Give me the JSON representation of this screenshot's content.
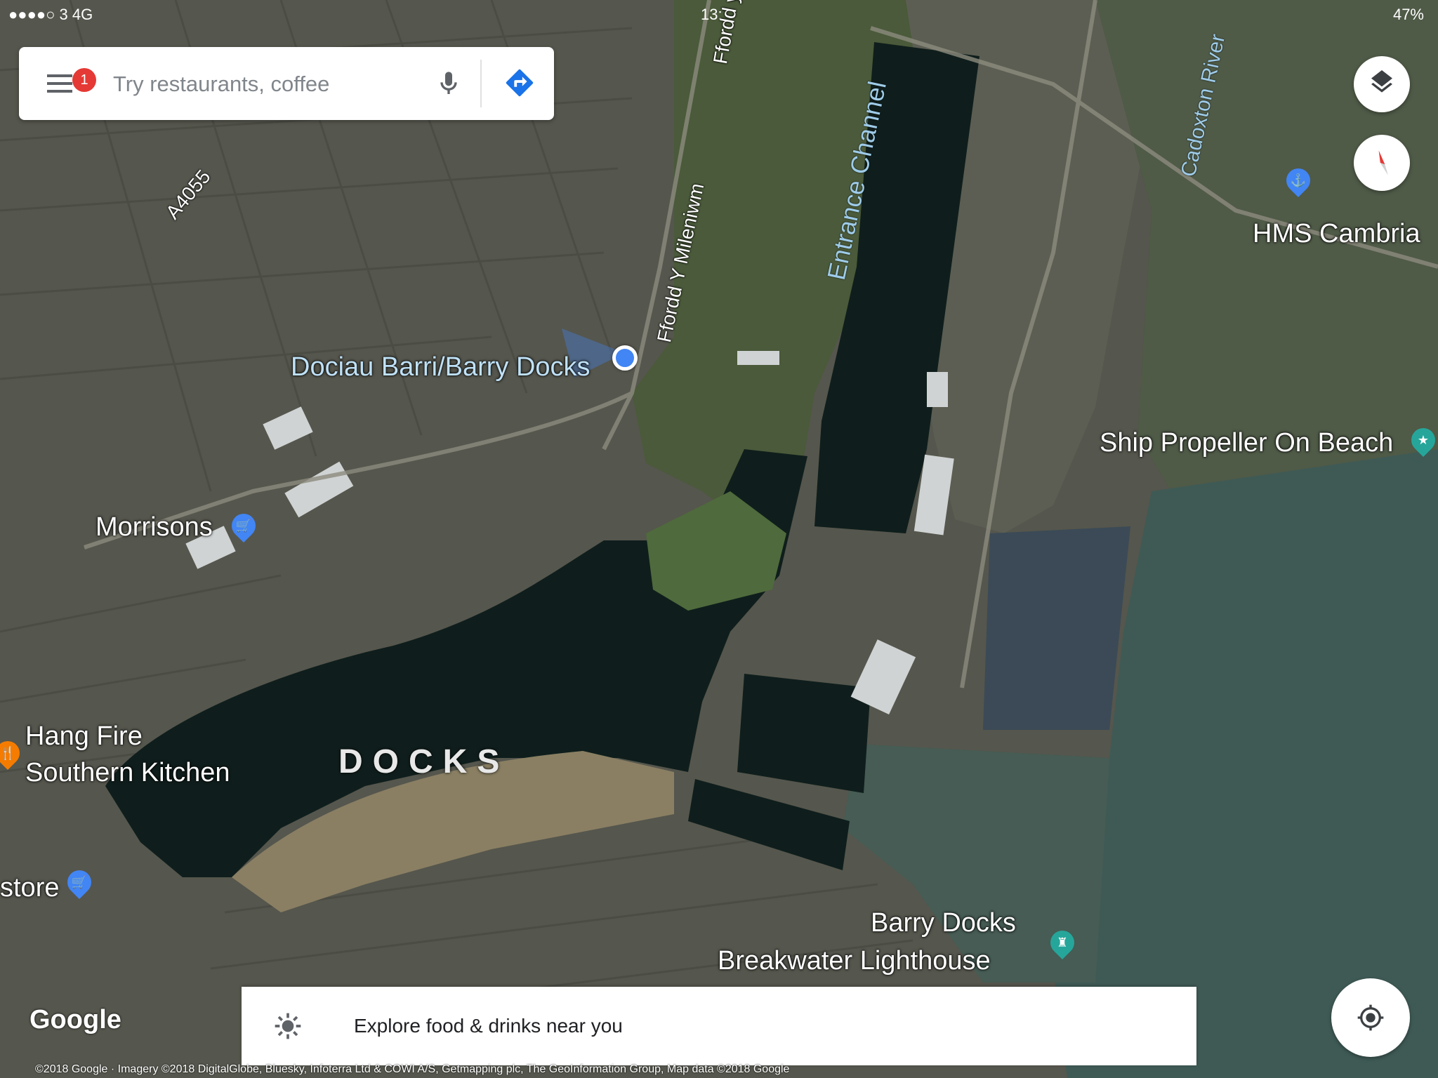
{
  "status_bar": {
    "left": "●●●●○ 3  4G",
    "time": "13:",
    "right": "47%"
  },
  "search": {
    "placeholder": "Try restaurants, coffee",
    "notification_count": "1"
  },
  "map_labels": {
    "barry_docks_station": "Dociau Barri/Barry Docks",
    "morrisons": "Morrisons",
    "hang_fire_line1": "Hang Fire",
    "hang_fire_line2": "Southern Kitchen",
    "store": "store",
    "docks": "DOCKS",
    "hms_cambria": "HMS Cambria",
    "ship_propeller": "Ship Propeller On Beach",
    "lighthouse_line1": "Barry Docks",
    "lighthouse_line2": "Breakwater Lighthouse",
    "entrance_channel": "Entrance Channel",
    "cadoxton_river": "Cadoxton River",
    "a4055": "A4055",
    "ffordd_y_mileniwm": "Ffordd Y Mileniwm",
    "ffordd_top": "Ffordd y"
  },
  "bottom_card": {
    "explore_text": "Explore food & drinks near you"
  },
  "branding": {
    "logo": "Google",
    "attribution": "©2018 Google · Imagery ©2018 DigitalGlobe, Bluesky, Infoterra Ltd & COWI A/S, Getmapping plc, The GeoInformation Group, Map data ©2018 Google"
  },
  "colors": {
    "accent_blue": "#4285f4",
    "badge_red": "#e53935",
    "water": "#0f1e1c",
    "sea": "#3f5a55",
    "land_green": "#3d5530",
    "urban": "#5a5a52"
  },
  "icons": [
    "menu-icon",
    "mic-icon",
    "directions-icon",
    "layers-icon",
    "compass-icon",
    "locate-icon",
    "explore-sun-icon",
    "shopping-pin-icon",
    "restaurant-pin-icon",
    "landmark-pin-icon"
  ]
}
